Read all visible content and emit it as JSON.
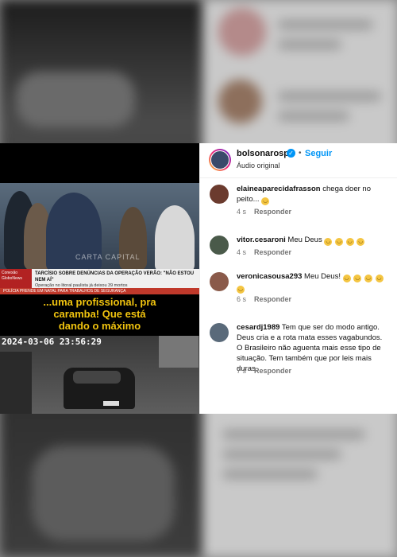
{
  "post": {
    "username": "bolsonarosp",
    "follow_label": "Seguir",
    "separator": "•",
    "audio": "Áudio original"
  },
  "video": {
    "news_banner_title": "TARCÍSIO SOBRE DENÚNCIAS DA OPERAÇÃO VERÃO: \"NÃO ESTOU NEM AÍ\"",
    "news_banner_subtitle": "Operação no litoral paulista já deixou 39 mortos",
    "logo_text": "Conexão GloboNews",
    "ticker": "POLÍCIA PRENDE EM NATAL PARA TRABALHOS DE SEGURANÇA",
    "watermark": "CARTA CAPITAL",
    "subtitle_line1": "...uma profissional, pra",
    "subtitle_line2": "caramba! Que está",
    "subtitle_line3": "dando o máximo",
    "cctv_timestamp": "2024-03-06  23:56:29"
  },
  "comments": [
    {
      "user": "elaineaparecidafrasson",
      "text": "chega doer no peito...",
      "time": "4 s",
      "reply": "Responder",
      "emoji_count": 1,
      "emoji_icon": "crying-face-icon",
      "avatar_color": "#6b3b2e"
    },
    {
      "user": "vitor.cesaroni",
      "text": "Meu Deus",
      "time": "4 s",
      "reply": "Responder",
      "emoji_count": 4,
      "emoji_icon": "sad-face-icon",
      "avatar_color": "#4a5a4a"
    },
    {
      "user": "veronicasousa293",
      "text": "Meu Deus!",
      "time": "6 s",
      "reply": "Responder",
      "emoji_count": 5,
      "emoji_icon": "teary-face-icon",
      "avatar_color": "#8a5a4a"
    },
    {
      "user": "cesardj1989",
      "text": "Tem que ser do modo antigo. Deus cria e a rota mata esses vagabundos. O Brasileiro não aguenta mais esse tipo de situação. Tem também que por leis mais duras.",
      "time": "7 s",
      "reply": "Responder",
      "emoji_count": 0,
      "emoji_icon": "",
      "avatar_color": "#5a6a7a"
    }
  ],
  "colors": {
    "accent": "#0095f6",
    "subtitle": "#f1c40f",
    "muted": "#737373"
  }
}
